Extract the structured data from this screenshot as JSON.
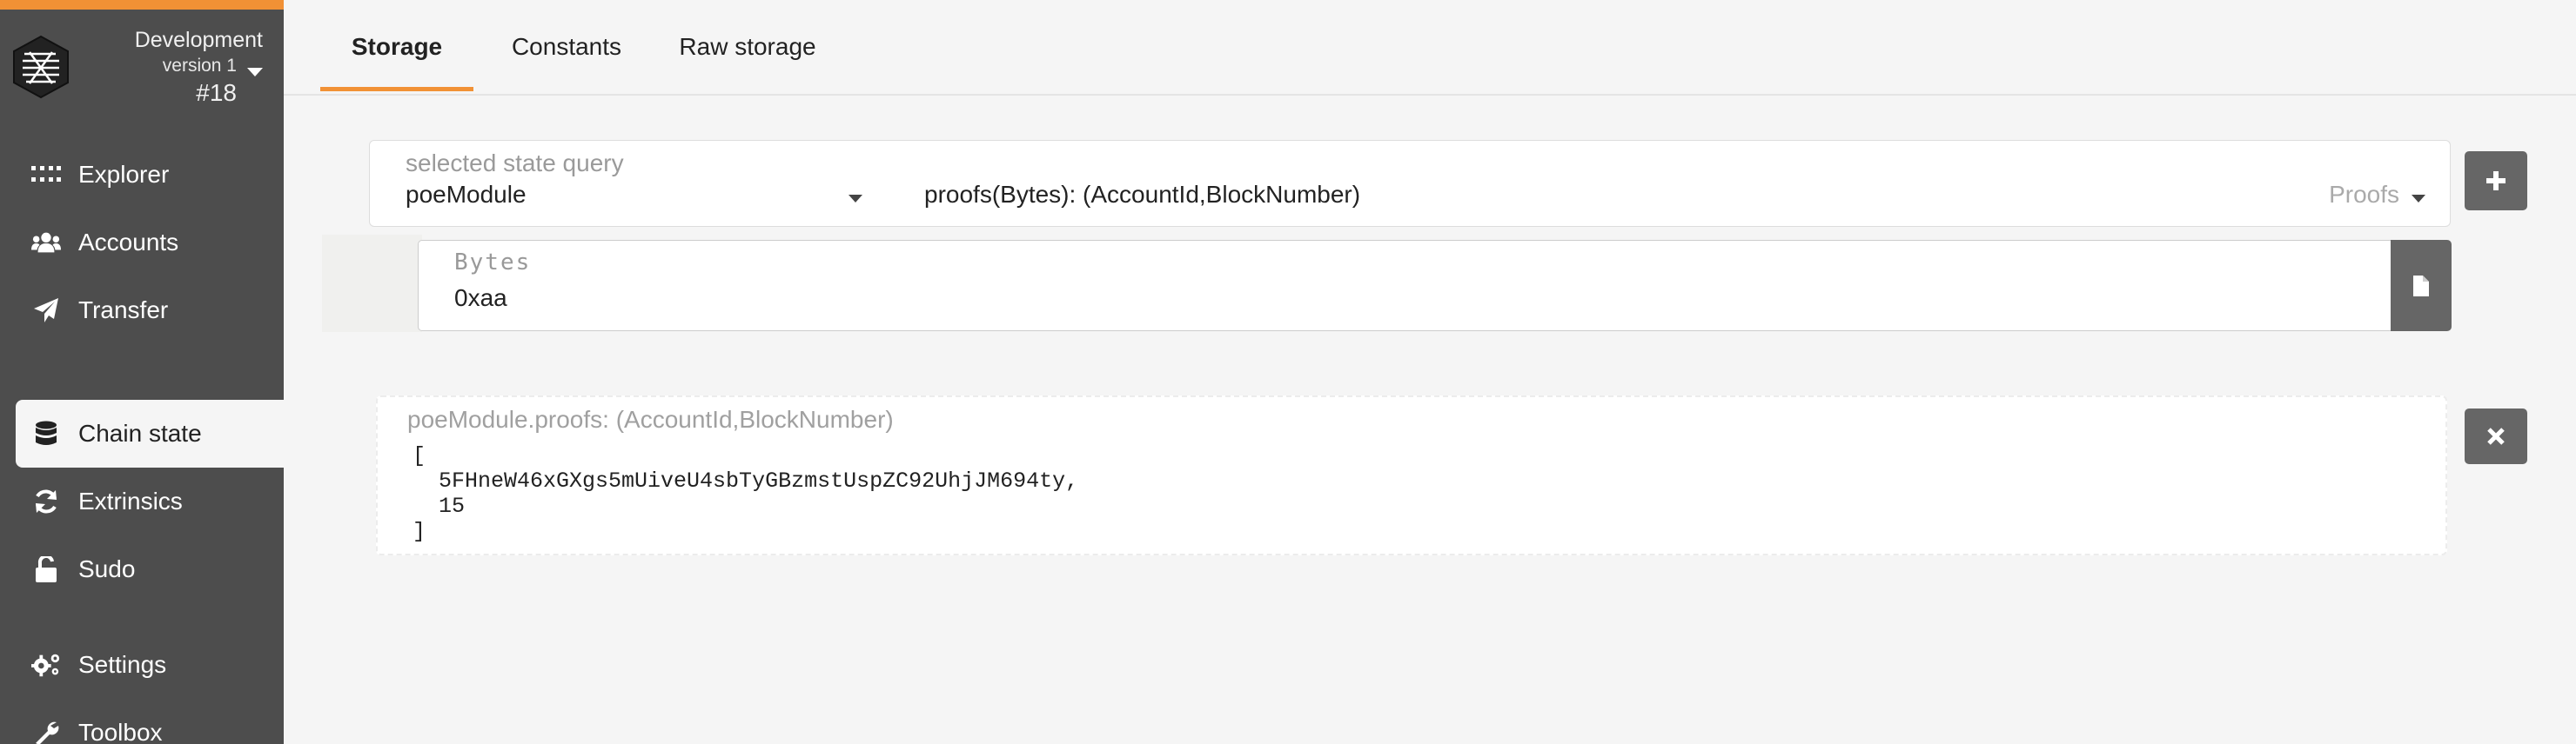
{
  "sidebar": {
    "chain_name": "Development",
    "chain_version": "version 1",
    "block_number": "#18",
    "items": [
      {
        "label": "Explorer",
        "icon": "grid-dots-icon"
      },
      {
        "label": "Accounts",
        "icon": "users-icon"
      },
      {
        "label": "Transfer",
        "icon": "paper-plane-icon"
      },
      {
        "label": "Chain state",
        "icon": "database-icon",
        "active": true
      },
      {
        "label": "Extrinsics",
        "icon": "sync-icon"
      },
      {
        "label": "Sudo",
        "icon": "unlock-icon"
      },
      {
        "label": "Settings",
        "icon": "gears-icon"
      },
      {
        "label": "Toolbox",
        "icon": "wrench-icon"
      }
    ]
  },
  "tabs": [
    {
      "label": "Storage",
      "active": true
    },
    {
      "label": "Constants"
    },
    {
      "label": "Raw storage"
    }
  ],
  "query": {
    "label": "selected state query",
    "module": "poeModule",
    "method": "proofs(Bytes): (AccountId,BlockNumber)",
    "section_hint": "Proofs"
  },
  "param": {
    "label": "Bytes",
    "value": "0xaa"
  },
  "result": {
    "label": "poeModule.proofs: (AccountId,BlockNumber)",
    "value": "[\n  5FHneW46xGXgs5mUiveU4sbTyGBzmstUspZC92UhjJM694ty,\n  15\n]"
  },
  "colors": {
    "accent": "#f19135",
    "sidebar": "#4d4d4d",
    "button": "#666666"
  }
}
